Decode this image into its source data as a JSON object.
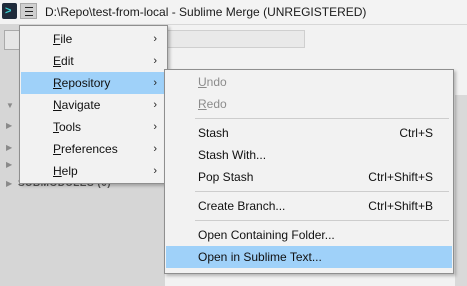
{
  "window": {
    "title": "D:\\Repo\\test-from-local - Sublime Merge (UNREGISTERED)",
    "app_icon_glyph": ">"
  },
  "sidebar": {
    "submodules_label": "SUBMODULES (0)"
  },
  "main_menu": {
    "items": [
      {
        "label": "File",
        "mnemonic": "F",
        "rest": "ile",
        "has_submenu": true
      },
      {
        "label": "Edit",
        "mnemonic": "E",
        "rest": "dit",
        "has_submenu": true
      },
      {
        "label": "Repository",
        "mnemonic": "R",
        "rest": "epository",
        "has_submenu": true
      },
      {
        "label": "Navigate",
        "mnemonic": "N",
        "rest": "avigate",
        "has_submenu": true
      },
      {
        "label": "Tools",
        "mnemonic": "T",
        "rest": "ools",
        "has_submenu": true
      },
      {
        "label": "Preferences",
        "mnemonic": "P",
        "rest": "references",
        "has_submenu": true
      },
      {
        "label": "Help",
        "mnemonic": "H",
        "rest": "elp",
        "has_submenu": true
      }
    ],
    "arrow_glyph": "›"
  },
  "repository_menu": {
    "items": [
      {
        "label": "Undo",
        "mnemonic": "U",
        "rest": "ndo",
        "shortcut": "",
        "enabled": false
      },
      {
        "label": "Redo",
        "mnemonic": "R",
        "rest": "edo",
        "shortcut": "",
        "enabled": false
      },
      {
        "label": "Stash",
        "shortcut": "Ctrl+S",
        "enabled": true
      },
      {
        "label": "Stash With...",
        "shortcut": "",
        "enabled": true
      },
      {
        "label": "Pop Stash",
        "shortcut": "Ctrl+Shift+S",
        "enabled": true
      },
      {
        "label": "Create Branch...",
        "shortcut": "Ctrl+Shift+B",
        "enabled": true
      },
      {
        "label": "Open Containing Folder...",
        "shortcut": "",
        "enabled": true
      },
      {
        "label": "Open in Sublime Text...",
        "shortcut": "",
        "enabled": true,
        "highlighted": true
      }
    ]
  },
  "colors": {
    "highlight": "#9fd1f9",
    "menu_bg": "#f2f2f2",
    "disabled_text": "#8c8c8c"
  }
}
